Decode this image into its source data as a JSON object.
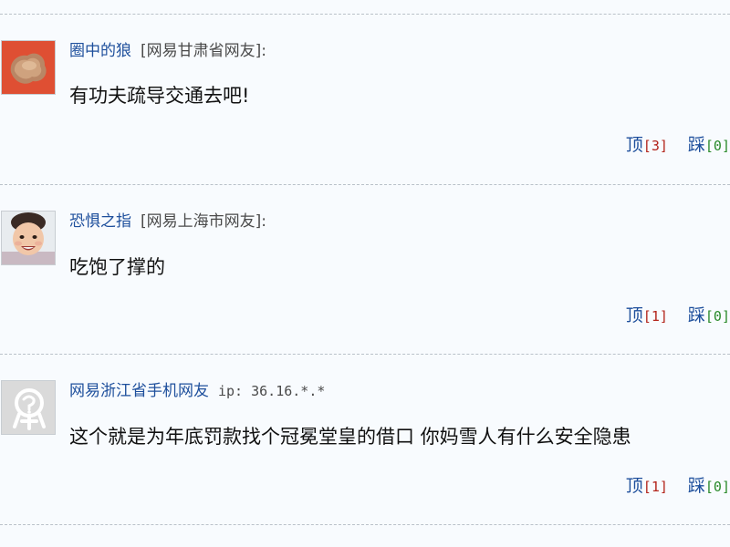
{
  "comments": [
    {
      "username": "圈中的狼",
      "location": "[网易甘肃省网友]:",
      "avatar_icon": "rock-avatar-icon",
      "text": "有功夫疏导交通去吧!",
      "up_label": "顶",
      "up_count": "[3]",
      "down_label": "踩",
      "down_count": "[0]"
    },
    {
      "username": "恐惧之指",
      "location": "[网易上海市网友]:",
      "avatar_icon": "baby-avatar-icon",
      "text": "吃饱了撑的",
      "up_label": "顶",
      "up_count": "[1]",
      "down_label": "踩",
      "down_count": "[0]"
    },
    {
      "username": "网易浙江省手机网友",
      "ip": "ip: 36.16.*.*",
      "avatar_icon": "default-user-avatar-icon",
      "text": "这个就是为年底罚款找个冠冕堂皇的借口 你妈雪人有什么安全隐患",
      "up_label": "顶",
      "up_count": "[1]",
      "down_label": "踩",
      "down_count": "[0]"
    }
  ],
  "colors": {
    "background": "#f8fbfe",
    "username": "#1e4f9c",
    "up_count": "#b3241b",
    "down_count": "#2a8a2a"
  }
}
